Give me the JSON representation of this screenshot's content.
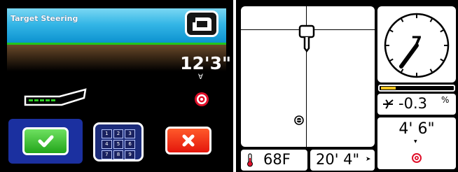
{
  "left_screen": {
    "title": "Target Steering",
    "target_depth": "12'3\"",
    "down_arrow_glyph": "∀",
    "buttons": {
      "confirm_icon": "checkmark-icon",
      "keypad_icon": "keypad-icon",
      "cancel_icon": "x-icon"
    },
    "keypad_keys": [
      "1",
      "2",
      "3",
      "4",
      "5",
      "6",
      "7",
      "8",
      "9"
    ],
    "colors": {
      "header": "#34b6e6",
      "confirm": "#22a51a",
      "cancel": "#e4160c",
      "target": "#e0102a"
    }
  },
  "right_screen": {
    "roll_value": "7",
    "pitch": {
      "value": "-0.3",
      "unit": "%"
    },
    "depth": "4' 6\"",
    "depth_arrow_glyph": "▼",
    "temperature": "68F",
    "distance": "20' 4\"",
    "distance_arrow_glyph": "➤",
    "battery_level_fraction": 0.2,
    "colors": {
      "battery": "#f3c622",
      "target": "#e0102a"
    }
  }
}
